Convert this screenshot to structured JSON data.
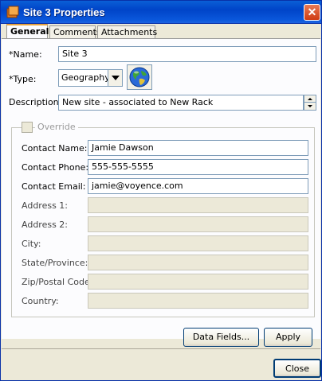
{
  "window": {
    "title": "Site 3 Properties",
    "close_glyph": "✕"
  },
  "tabs": [
    {
      "label": "General",
      "active": true
    },
    {
      "label": "Comments",
      "active": false
    },
    {
      "label": "Attachments",
      "active": false
    }
  ],
  "form": {
    "name": {
      "label": "*Name:",
      "value": "Site 3"
    },
    "type": {
      "label": "*Type:",
      "value": "Geography"
    },
    "description": {
      "label": "Description:",
      "value": "New site - associated to New Rack"
    }
  },
  "override": {
    "label": "Override",
    "checked": false,
    "fields": [
      {
        "label": "Contact Name:",
        "value": "Jamie Dawson",
        "enabled": true
      },
      {
        "label": "Contact Phone:",
        "value": "555-555-5555",
        "enabled": true
      },
      {
        "label": "Contact Email:",
        "value": "jamie@voyence.com",
        "enabled": true
      },
      {
        "label": "Address 1:",
        "value": "",
        "enabled": false
      },
      {
        "label": "Address 2:",
        "value": "",
        "enabled": false
      },
      {
        "label": "City:",
        "value": "",
        "enabled": false
      },
      {
        "label": "State/Province:",
        "value": "",
        "enabled": false
      },
      {
        "label": "Zip/Postal Code:",
        "value": "",
        "enabled": false
      },
      {
        "label": "Country:",
        "value": "",
        "enabled": false
      }
    ]
  },
  "buttons": {
    "data_fields": "Data Fields...",
    "apply": "Apply",
    "close": "Close"
  },
  "icons": {
    "window": "site-icon",
    "globe": "globe-icon"
  }
}
